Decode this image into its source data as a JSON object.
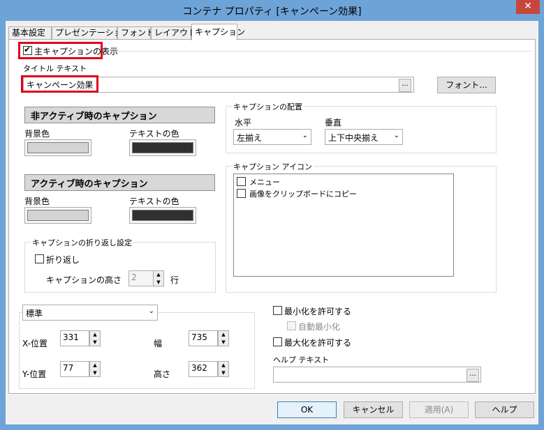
{
  "window": {
    "title": "コンテナ プロパティ [キャンペーン効果]",
    "close_glyph": "✕"
  },
  "tabs": [
    {
      "label": "基本設定",
      "active": false
    },
    {
      "label": "プレゼンテーション",
      "active": false
    },
    {
      "label": "フォント",
      "active": false
    },
    {
      "label": "レイアウト",
      "active": false
    },
    {
      "label": "キャプション",
      "active": true
    }
  ],
  "caption": {
    "show_caption_label": "主キャプションの表示",
    "show_caption_checked": true,
    "title_text_label": "タイトル テキスト",
    "title_text_value": "キャンペーン効果",
    "dots_button": "...",
    "font_button": "フォント..."
  },
  "inactive": {
    "header": "非アクティブ時のキャプション",
    "bg_label": "背景色",
    "text_label": "テキストの色",
    "bg_color": "#d4d4d4",
    "text_color": "#303030"
  },
  "active": {
    "header": "アクティブ時のキャプション",
    "bg_label": "背景色",
    "text_label": "テキストの色",
    "bg_color": "#d4d4d4",
    "text_color": "#303030"
  },
  "wrap": {
    "group_title": "キャプションの折り返し設定",
    "wrap_label": "折り返し",
    "wrap_checked": false,
    "height_label": "キャプションの高さ",
    "height_value": "2",
    "unit_label": "行"
  },
  "placement": {
    "group_title": "キャプションの配置",
    "horizontal_label": "水平",
    "horizontal_value": "左揃え",
    "vertical_label": "垂直",
    "vertical_value": "上下中央揃え"
  },
  "icons": {
    "group_title": "キャプション アイコン",
    "items": [
      {
        "label": "メニュー",
        "checked": false
      },
      {
        "label": "画像をクリップボードにコピー",
        "checked": false
      }
    ]
  },
  "position": {
    "mode_value": "標準",
    "x_label": "X-位置",
    "x_value": "331",
    "y_label": "Y-位置",
    "y_value": "77",
    "width_label": "幅",
    "width_value": "735",
    "height_label": "高さ",
    "height_value": "362"
  },
  "window_opts": {
    "allow_minimize_label": "最小化を許可する",
    "auto_minimize_label": "自動最小化",
    "allow_maximize_label": "最大化を許可する",
    "help_text_label": "ヘルプ テキスト",
    "help_text_value": ""
  },
  "buttons": {
    "ok": "OK",
    "cancel": "キャンセル",
    "apply": "適用(A)",
    "help": "ヘルプ"
  },
  "colors": {
    "annotation_red": "#e0001b",
    "title_bar": "#6ea3d8"
  }
}
